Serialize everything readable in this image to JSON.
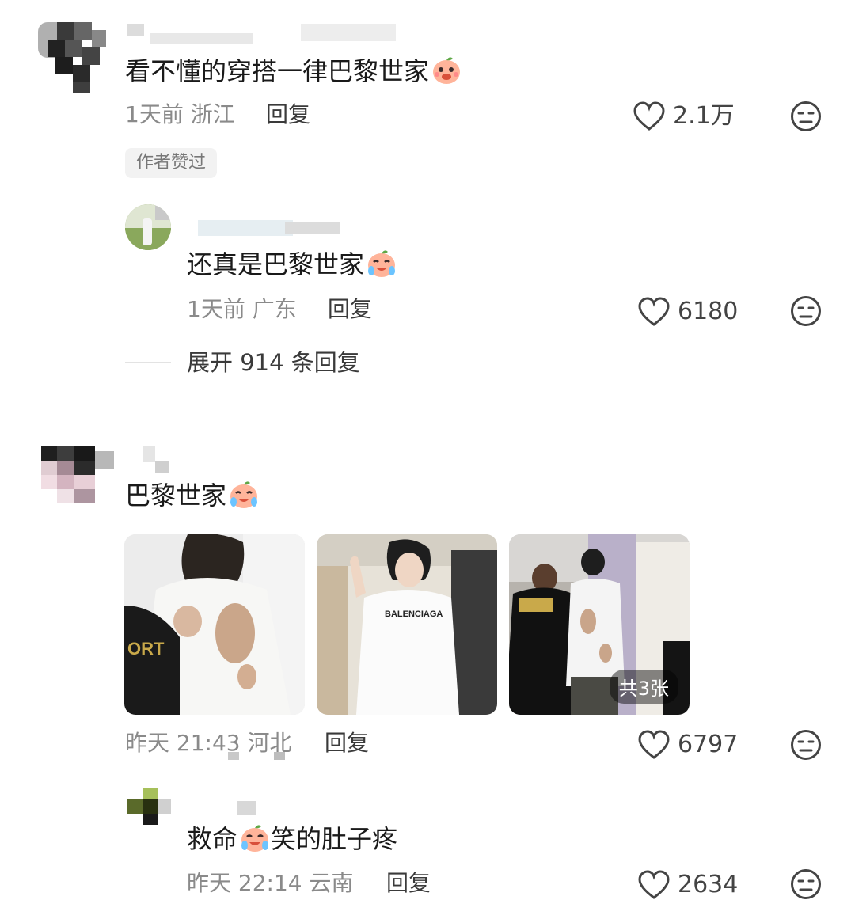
{
  "comments": [
    {
      "text": "看不懂的穿搭一律巴黎世家",
      "emoji": "laughing-peach-emoji",
      "time": "1天前",
      "location": "浙江",
      "reply_label": "回复",
      "likes": "2.1万",
      "badge": "作者赞过"
    },
    {
      "text": "还真是巴黎世家",
      "emoji": "crying-laughing-peach-emoji",
      "time": "1天前",
      "location": "广东",
      "reply_label": "回复",
      "likes": "6180"
    },
    {
      "text": "巴黎世家",
      "emoji": "crying-laughing-peach-emoji",
      "time": "昨天 21:43",
      "location": "河北",
      "reply_label": "回复",
      "likes": "6797",
      "photo_count": "共3张",
      "photo_brand_text": "BALENCIAGA"
    },
    {
      "text_before": "救命",
      "text_after": "笑的肚子疼",
      "emoji": "crying-laughing-peach-emoji",
      "time": "昨天 22:14",
      "location": "云南",
      "reply_label": "回复",
      "likes": "2634"
    }
  ],
  "expand_replies": "展开 914 条回复",
  "colors": {
    "text": "#1a1a1a",
    "meta": "#8a8a8a",
    "badge_bg": "#f2f2f2"
  }
}
